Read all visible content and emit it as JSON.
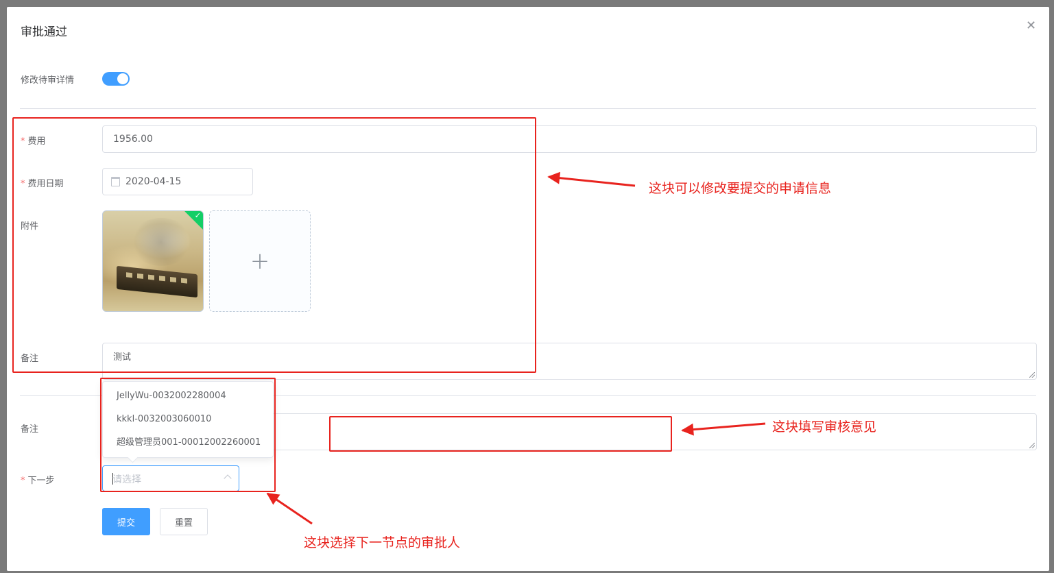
{
  "dialog": {
    "title": "审批通过",
    "close_icon": "close-icon"
  },
  "form": {
    "edit_toggle_label": "修改待审详情",
    "edit_toggle_on": true,
    "fee": {
      "label": "费用",
      "value": "1956.00"
    },
    "fee_date": {
      "label": "费用日期",
      "value": "2020-04-15"
    },
    "attachment": {
      "label": "附件",
      "upload_icon": "plus-icon",
      "uploaded_count": 1
    },
    "remark": {
      "label": "备注",
      "value": "测试"
    }
  },
  "review": {
    "remark_label": "备注",
    "remark_value": "",
    "next_step_label": "下一步",
    "next_step_placeholder": "请选择",
    "options": [
      "JellyWu-0032002280004",
      "kkkl-0032003060010",
      "超级管理员001-00012002260001"
    ]
  },
  "buttons": {
    "submit": "提交",
    "reset": "重置"
  },
  "annotations": {
    "edit_info": "这块可以修改要提交的申请信息",
    "review_opinion": "这块填写审核意见",
    "choose_approver": "这块选择下一节点的审批人",
    "color": "#e8231e"
  },
  "colors": {
    "primary": "#409eff",
    "required": "#f56c6c",
    "success": "#13ce66"
  }
}
